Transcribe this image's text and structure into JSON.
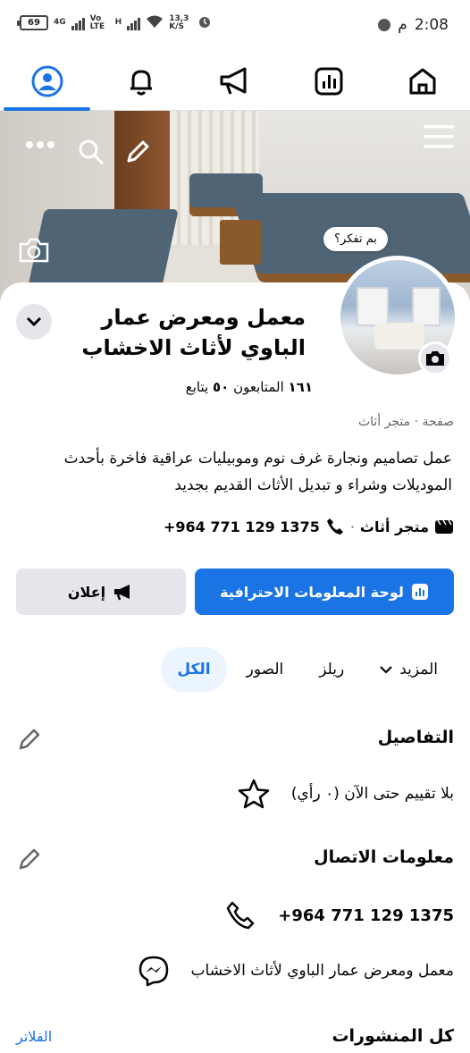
{
  "status_bar": {
    "time": "2:08",
    "am_pm": "م",
    "battery": "69",
    "network_4g": "4G",
    "volte": "Vo LTE",
    "network_h": "H",
    "speed": "13,3 K/S"
  },
  "nav_tabs": [
    {
      "id": "profile",
      "icon": "profile-icon",
      "active": true
    },
    {
      "id": "notifications",
      "icon": "bell-icon",
      "active": false
    },
    {
      "id": "ads",
      "icon": "megaphone-icon",
      "active": false
    },
    {
      "id": "insights",
      "icon": "chart-icon",
      "active": false
    },
    {
      "id": "home",
      "icon": "home-icon",
      "active": false
    }
  ],
  "cover": {
    "thought_bubble": "بم تفكر؟"
  },
  "page": {
    "name": "معمل ومعرض عمار الباوي لأثاث الاخشاب",
    "followers_count": "١٦١",
    "followers_label": "المتابعون",
    "following_count": "٥٠",
    "following_label": "يتابع",
    "category": "صفحة · متجر أثاث",
    "bio": "عمل تصاميم ونجارة غرف نوم وموبيليات عراقية فاخرة بأحدث الموديلات وشراء و تبديل الأثاث القديم بجديد",
    "category_short": "متجر أثاث",
    "phone": "+964 771 129 1375"
  },
  "buttons": {
    "dashboard": "لوحة المعلومات الاحترافية",
    "ad": "إعلان"
  },
  "filter_tabs": {
    "all": "الكل",
    "photos": "الصور",
    "reels": "ريلز",
    "more": "المزيد"
  },
  "details": {
    "title": "التفاصيل",
    "rating": "بلا تقييم حتى الآن (٠ رأي)"
  },
  "contact": {
    "title": "معلومات الاتصال",
    "phone": "+964 771 129 1375",
    "messenger": "معمل ومعرض عمار الباوي لأثاث الاخشاب"
  },
  "posts": {
    "title": "كل المنشورات",
    "filters": "الفلاتر"
  },
  "colors": {
    "accent": "#1b74e4",
    "secondary_button": "#e4e6eb"
  }
}
